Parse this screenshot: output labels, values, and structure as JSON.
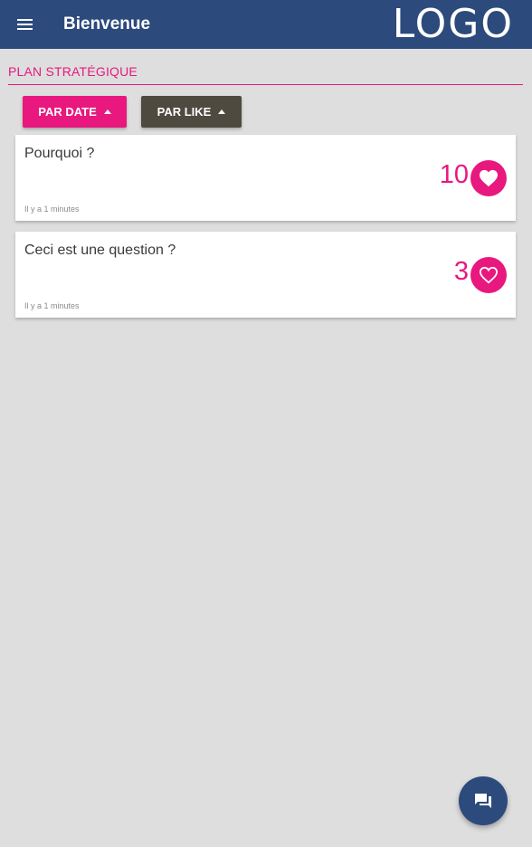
{
  "header": {
    "title": "Bienvenue",
    "logo": "LOGO",
    "menu_icon": "menu-icon"
  },
  "section": {
    "title": "PLAN STRATÉGIQUE"
  },
  "sort": {
    "by_date_label": "PAR DATE",
    "by_like_label": "PAR LIKE"
  },
  "questions": [
    {
      "text": "Pourquoi ?",
      "time": "Il y a 1 minutes",
      "likes": "10",
      "liked": true
    },
    {
      "text": "Ceci est une question ?",
      "time": "Il y a 1 minutes",
      "likes": "3",
      "liked": false
    }
  ],
  "fab": {
    "icon": "chat-icon"
  },
  "colors": {
    "primary": "#2c4a7c",
    "accent": "#e8187e",
    "secondary_button": "#4f4a40",
    "background": "#dedede"
  }
}
